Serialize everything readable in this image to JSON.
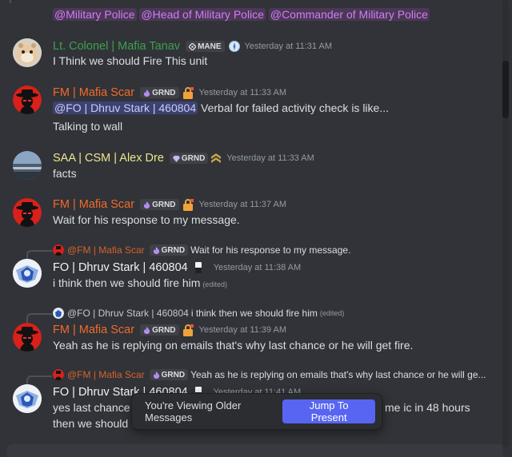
{
  "colors": {
    "mafia_red": "#ff6a2a",
    "ltcol_green": "#3aa24a",
    "alex_yellow": "#f0e68c",
    "dhruv_white": "#f2f3f5",
    "role_mp": "#c050e6",
    "role_bg": "rgba(192,80,230,0.2)"
  },
  "top_roles": {
    "role1": "@Military Police",
    "role2": "@Head of Military Police",
    "role3": "@Commander of Military Police"
  },
  "messages": [
    {
      "author": "Lt. Colonel | Mafia Tanav",
      "tag": "MANE",
      "timestamp": "Yesterday at 11:31 AM",
      "text": "I Think we should Fire This unit"
    },
    {
      "author": "FM | Mafia Scar",
      "tag": "GRND",
      "timestamp": "Yesterday at 11:33 AM",
      "mention": "@FO | Dhruv Stark | 460804",
      "text": " Verbal for failed activity check is like...",
      "text2": "Talking to wall"
    },
    {
      "author": "SAA | CSM | Alex Dre",
      "tag": "GRND",
      "timestamp": "Yesterday at 11:33 AM",
      "text": "facts"
    },
    {
      "author": "FM | Mafia Scar",
      "tag": "GRND",
      "timestamp": "Yesterday at 11:37 AM",
      "text": "Wait for his response to my message."
    },
    {
      "reply_author": "@FM | Mafia Scar",
      "reply_tag": "GRND",
      "reply_text": "Wait for his response to my message.",
      "author": "FO | Dhruv Stark | 460804",
      "timestamp": "Yesterday at 11:38 AM",
      "text": "i think then we should fire him",
      "edited": "(edited)"
    },
    {
      "reply_author": "@FO | Dhruv Stark | 460804",
      "reply_text": "i think then we should fire him",
      "reply_edited": "(edited)",
      "author": "FM | Mafia Scar",
      "tag": "GRND",
      "timestamp": "Yesterday at 11:39 AM",
      "text": "Yeah as he is replying on emails that's why last chance or he will get fire."
    },
    {
      "reply_author": "@FM | Mafia Scar",
      "reply_tag": "GRND",
      "reply_text": "Yeah as he is replying on emails that's why last chance or he will ge...",
      "author": "FO | Dhruv Stark | 460804",
      "timestamp": "Yesterday at 11:41 AM",
      "text_left": "yes last chance",
      "text_right": "me ic in 48 hours",
      "text2": "then we should f"
    }
  ],
  "older_bar": {
    "label": "You're Viewing Older Messages",
    "button": "Jump To Present"
  }
}
